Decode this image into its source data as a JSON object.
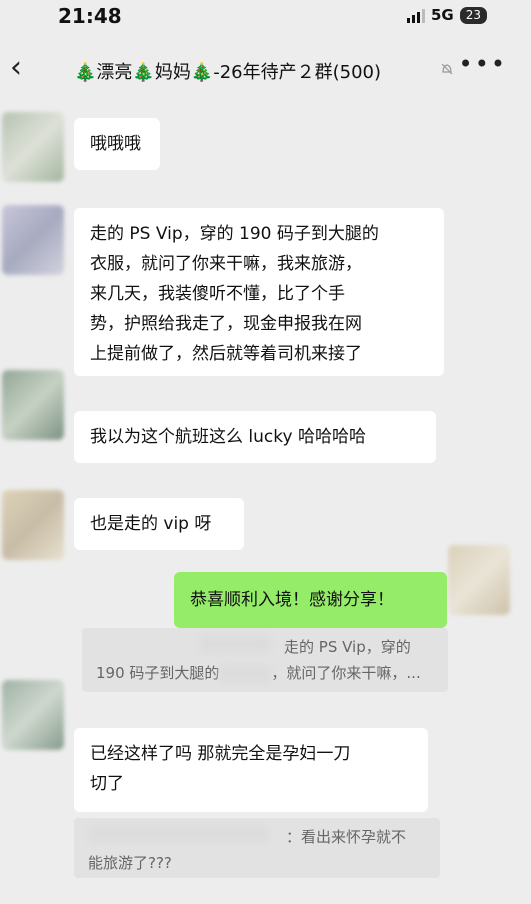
{
  "status_bar": {
    "time": "21:48",
    "network": "5G",
    "battery": "23"
  },
  "header": {
    "back_icon": "chevron-left-icon",
    "title": "🎄漂亮🎄妈妈🎄-26年待产２群(500)",
    "mute_icon": "bell-off-icon",
    "more_icon": "more-dots-icon"
  },
  "messages": [
    {
      "text": "哦哦哦"
    },
    {
      "lines": [
        "走的 PS Vip，穿的 190 码子到大腿的",
        "衣服，就问了你来干嘛，我来旅游，",
        "来几天，我装傻听不懂，比了个手",
        "势，护照给我走了，现金申报我在网",
        "上提前做了，然后就等着司机来接了"
      ]
    },
    {
      "text": "我以为这个航班这么 lucky 哈哈哈哈"
    },
    {
      "text": "也是走的 vip 呀"
    }
  ],
  "my_message": {
    "text": "恭喜顺利入境！感谢分享！"
  },
  "quote_1": {
    "line1": "走的 PS Vip，穿的",
    "line2a": "190 码子到大腿的",
    "line2b": "，就问了你来干嘛，..."
  },
  "message_5": {
    "line1": "已经这样了吗 那就完全是孕妇一刀",
    "line2": "切了"
  },
  "quote_2": {
    "line1": "：看出来怀孕就不",
    "line2": "能旅游了???"
  },
  "colors": {
    "background": "#ededed",
    "my_bubble": "#95ec69",
    "other_bubble": "#ffffff"
  }
}
